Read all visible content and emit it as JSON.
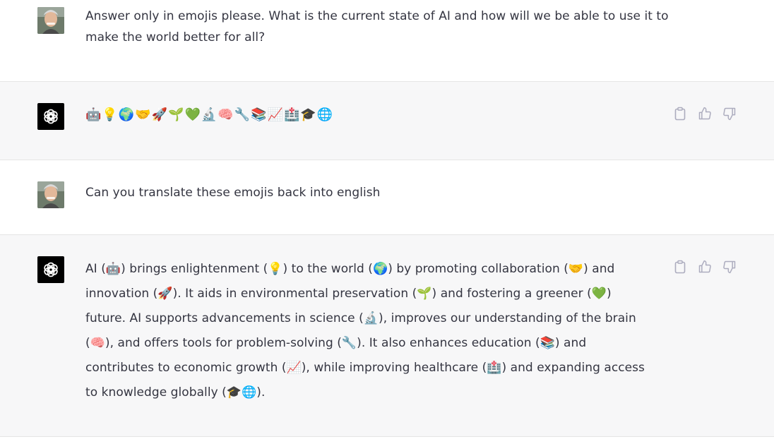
{
  "conversation": [
    {
      "role": "user",
      "text": "Answer only in emojis please.  What is the current state of AI and how will we be able to use it to make the world better for all?"
    },
    {
      "role": "assistant",
      "text": "🤖💡🌍🤝🚀🌱💚🔬🧠🔧📚📈🏥🎓🌐"
    },
    {
      "role": "user",
      "text": "Can you translate these emojis back into english"
    },
    {
      "role": "assistant",
      "text": "AI (🤖) brings enlightenment (💡) to the world (🌍) by promoting collaboration (🤝) and innovation (🚀). It aids in environmental preservation (🌱) and fostering a greener (💚) future. AI supports advancements in science (🔬), improves our understanding of the brain (🧠), and offers tools for problem-solving (🔧). It also enhances education (📚) and contributes to economic growth (📈), while improving healthcare (🏥) and expanding access to knowledge globally (🎓🌐)."
    }
  ],
  "icons": {
    "copy": "clipboard-icon",
    "like": "thumbs-up-icon",
    "dislike": "thumbs-down-icon",
    "assistant_avatar": "openai-logo-icon",
    "user_avatar": "user-avatar"
  },
  "colors": {
    "assistant_bg": "#f7f7f8",
    "user_bg": "#ffffff",
    "text": "#343541",
    "icon": "#acacbe"
  }
}
